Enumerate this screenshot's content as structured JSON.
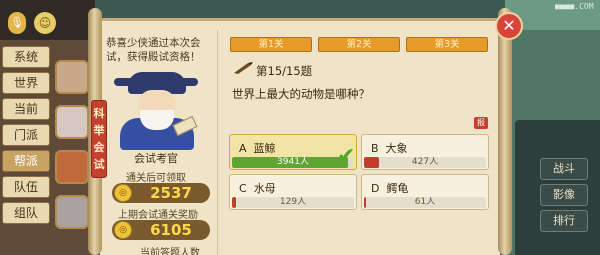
{
  "chat": {
    "mic_icon": "mic-icon",
    "emoji_icon": "emoji-icon"
  },
  "side_tabs": [
    "系统",
    "世界",
    "当前",
    "门派",
    "帮派",
    "队伍",
    "组队"
  ],
  "active_tab": "帮派",
  "right_panel": {
    "logo_text": "■■■■.COM",
    "buttons": [
      "战斗",
      "影像",
      "排行"
    ]
  },
  "exam": {
    "notice": "恭喜少侠通过本次会试，获得殿试资格！",
    "ribbon_title": "科举会试",
    "examiner_name": "会试考官",
    "reward_label": "通关后可领取",
    "reward_value": "2537",
    "last_reward_label": "上期会试通关奖励",
    "last_reward_value": "6105",
    "bottom_label": "当前答题人数"
  },
  "rounds": [
    "第1关",
    "第2关",
    "第3关"
  ],
  "question": {
    "number": "第15/15题",
    "text": "世界上最大的动物是哪种？",
    "report_icon": "report-icon"
  },
  "options": [
    {
      "letter": "A",
      "label": "蓝鲸",
      "count": "3941人",
      "share": 0.95,
      "selected": true
    },
    {
      "letter": "B",
      "label": "大象",
      "count": "427人",
      "share": 0.12,
      "selected": false
    },
    {
      "letter": "C",
      "label": "水母",
      "count": "129人",
      "share": 0.03,
      "selected": false
    },
    {
      "letter": "D",
      "label": "鳄龟",
      "count": "61人",
      "share": 0.015,
      "selected": false
    }
  ],
  "colors": {
    "correct_fill": "#5ea534",
    "wrong_fill": "#c23d2b",
    "tab_orange": "#e79b28",
    "parchment": "#efe4c8"
  },
  "close_label": "✕"
}
